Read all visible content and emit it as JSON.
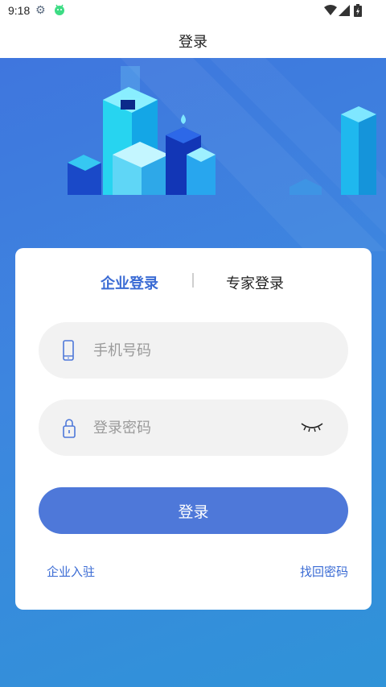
{
  "status_bar": {
    "time": "9:18",
    "icons": [
      "gear-icon",
      "android-icon",
      "wifi-icon",
      "signal-icon",
      "battery-icon"
    ]
  },
  "nav": {
    "title": "登录"
  },
  "tabs": [
    {
      "label": "企业登录",
      "active": true
    },
    {
      "label": "专家登录",
      "active": false
    }
  ],
  "phone_field": {
    "placeholder": "手机号码",
    "icon": "phone-icon"
  },
  "password_field": {
    "placeholder": "登录密码",
    "icon": "lock-icon",
    "toggle_icon": "eye-closed-icon"
  },
  "login_button": {
    "label": "登录"
  },
  "links": {
    "register": "企业入驻",
    "forgot": "找回密码"
  },
  "colors": {
    "accent": "#3a6bd4",
    "button": "#4e78d9",
    "hero_start": "#3f76de",
    "hero_end": "#2f93d8",
    "field_bg": "#f2f2f2"
  }
}
